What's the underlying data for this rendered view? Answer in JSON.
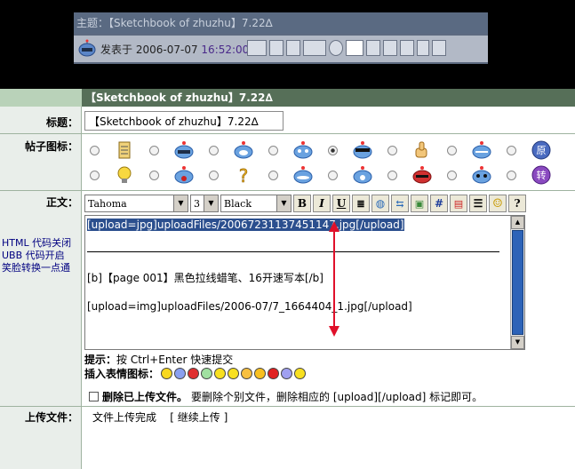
{
  "preview": {
    "title": "主题：【Sketchbook of zhuzhu】7.22∆",
    "posted_label": "发表于",
    "date": "2006-07-07",
    "time": "16:52:00",
    "toolbar_icons": [
      "bbs-icon",
      "home-icon",
      "user-icon",
      "pm-icon",
      "www-icon",
      "edit-icon",
      "forward-icon",
      "recycle-icon",
      "download-icon",
      "pen-icon",
      "computer-icon"
    ]
  },
  "form": {
    "header": "【Sketchbook of zhuzhu】7.22∆",
    "title_label": "标题：",
    "title_value": "【Sketchbook of zhuzhu】7.22∆",
    "icon_label": "帖子图标：",
    "body_label": "正文：",
    "side_links": [
      "HTML 代码关闭",
      "UBB 代码开启",
      "笑脸转换一点通"
    ],
    "toolbar": {
      "font": "Tahoma",
      "size": "3",
      "color": "Black",
      "bold": "B",
      "italic": "I",
      "underline": "U",
      "hash": "#"
    },
    "editor": {
      "line1": "[upload=jpg]uploadFiles/20067231137451147.jpg[/upload]",
      "line2": "[b]【page 001】黑色拉线蜡笔、16开速写本[/b]",
      "line3": "[upload=img]uploadFiles/2006-07/7_1664404_1.jpg[/upload]"
    },
    "hint_label": "提示：",
    "hint_text": "按 Ctrl+Enter 快速提交",
    "emoticon_label": "插入表情图标：",
    "delete_label": "删除已上传文件。",
    "delete_note": "要删除个别文件，删除相应的 [upload][/upload] 标记即可。",
    "upload_label": "上传文件：",
    "upload_status": "文件上传完成",
    "continue_link": "[ 继续上传 ]"
  },
  "colors": {
    "header_bg": "#566f58",
    "selection": "#2b4f8e",
    "annotation_arrow": "#e0102a"
  }
}
